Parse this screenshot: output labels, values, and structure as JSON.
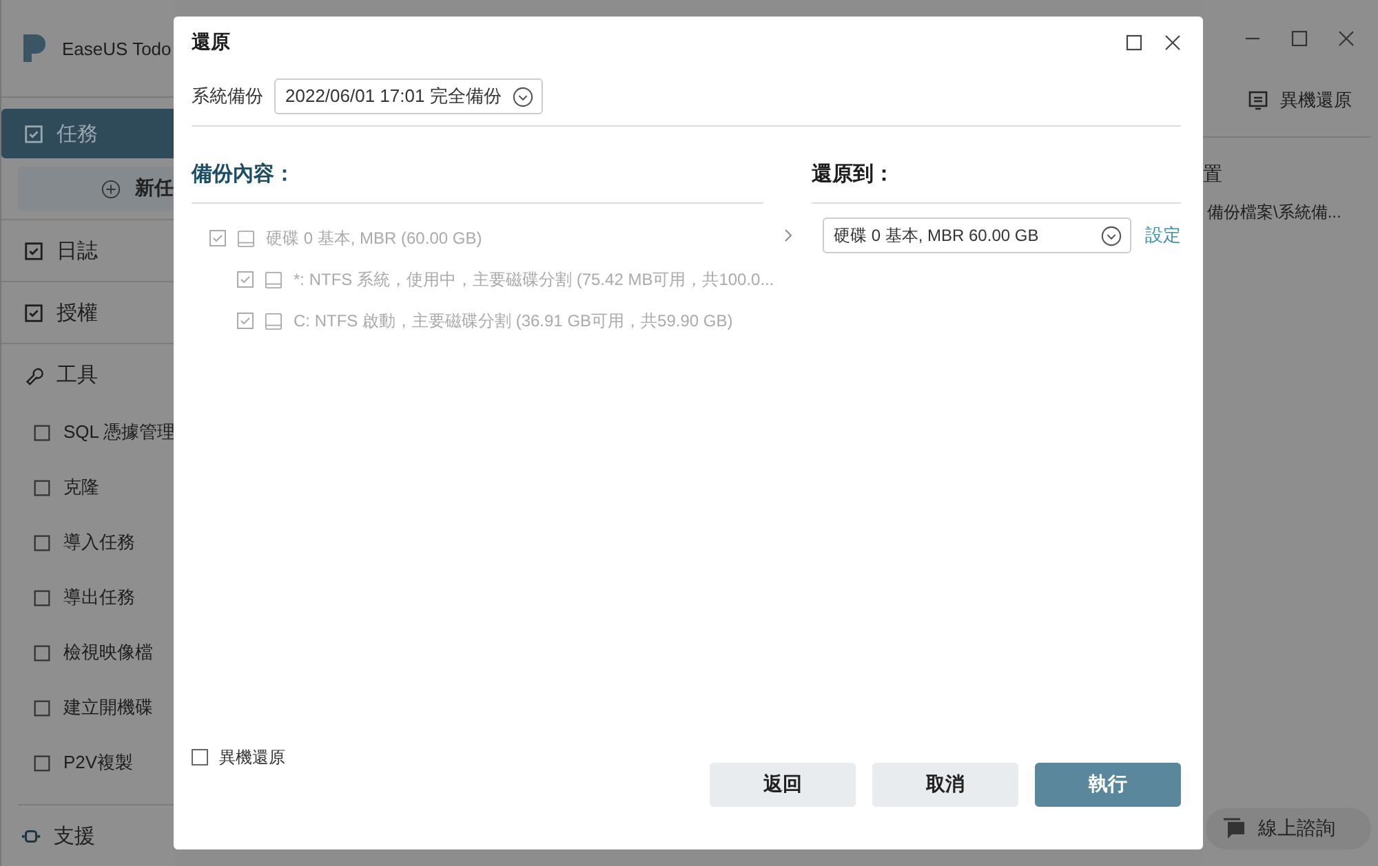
{
  "app": {
    "title": "EaseUS Todo",
    "sidebar": [
      {
        "kind": "nav",
        "label": "任務",
        "selected": true
      },
      {
        "kind": "button",
        "label": "新任"
      },
      {
        "kind": "nav",
        "label": "日誌",
        "selected": false
      },
      {
        "kind": "nav",
        "label": "授權",
        "selected": false
      },
      {
        "kind": "section",
        "label": "工具"
      },
      {
        "kind": "tool",
        "label": "SQL 憑據管理"
      },
      {
        "kind": "tool",
        "label": "克隆"
      },
      {
        "kind": "tool",
        "label": "導入任務"
      },
      {
        "kind": "tool",
        "label": "導出任務"
      },
      {
        "kind": "tool",
        "label": "檢視映像檔"
      },
      {
        "kind": "tool",
        "label": "建立開機碟"
      },
      {
        "kind": "tool",
        "label": "P2V複製"
      }
    ],
    "support": "支援",
    "toolbar_button": "異機還原",
    "location_heading": "置",
    "location_path": "備份檔案\\系統備...",
    "chat_button": "線上諮詢"
  },
  "dialog": {
    "title": "還原",
    "backup_label": "系統備份",
    "backup_select": "2022/06/01 17:01 完全備份",
    "content_heading": "備份內容：",
    "target_heading": "還原到：",
    "tree": [
      {
        "label": "硬碟 0 基本, MBR (60.00 GB)",
        "checked": true,
        "disabled": true,
        "children": [
          {
            "label": "*: NTFS 系統，使用中，主要磁碟分割 (75.42 MB可用，共100.0...",
            "checked": true,
            "disabled": true
          },
          {
            "label": "C: NTFS 啟動，主要磁碟分割 (36.91 GB可用，共59.90 GB)",
            "checked": true,
            "disabled": true
          }
        ]
      }
    ],
    "target_select": "硬碟 0 基本, MBR 60.00 GB",
    "settings_link": "設定",
    "other_machine": {
      "label": "異機還原",
      "checked": false
    },
    "buttons": [
      {
        "label": "返回",
        "kind": "secondary"
      },
      {
        "label": "取消",
        "kind": "secondary"
      },
      {
        "label": "執行",
        "kind": "primary"
      }
    ]
  }
}
